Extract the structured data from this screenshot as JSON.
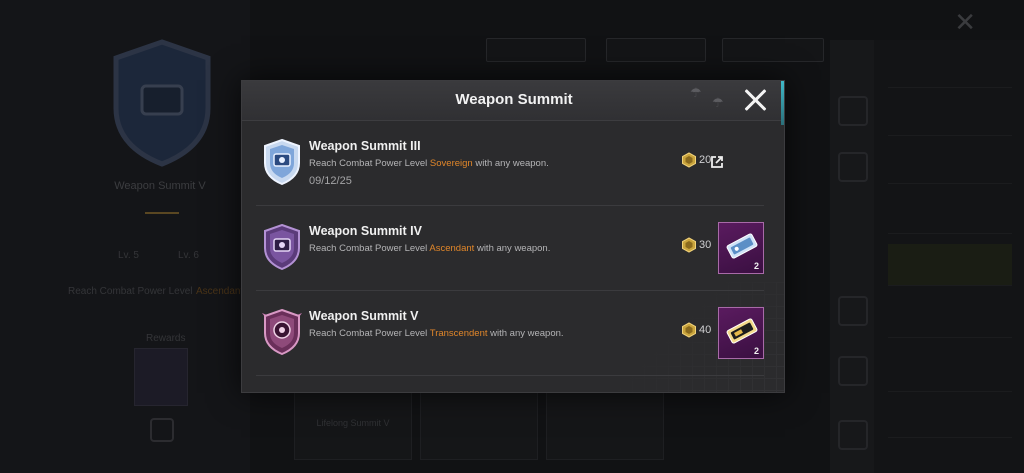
{
  "background": {
    "top_right_label": "",
    "left_panel": {
      "badge_name": "Weapon Summit V",
      "progress_left": "Lv. 5",
      "progress_right": "Lv. 6",
      "hint_text": "Reach Combat Power Level",
      "hint_highlight": "Ascendant",
      "rewards_label": "Rewards"
    },
    "filters": [
      "",
      "",
      ""
    ],
    "right_menu": [
      "",
      "",
      "",
      "",
      "",
      "",
      "",
      "",
      ""
    ],
    "bottom_cards": [
      "Lifelong Summit V",
      "",
      ""
    ]
  },
  "modal": {
    "title": "Weapon Summit",
    "rows": [
      {
        "title": "Weapon Summit III",
        "desc_before": "Reach Combat Power Level ",
        "desc_highlight": "Sovereign",
        "desc_after": " with any weapon.",
        "date": "09/12/25",
        "points": "20",
        "has_link": true,
        "badge_color": "#8fb5e8",
        "badge_tier": "silver-blue"
      },
      {
        "title": "Weapon Summit IV",
        "desc_before": "Reach Combat Power Level ",
        "desc_highlight": "Ascendant",
        "desc_after": " with any weapon.",
        "date": "",
        "points": "30",
        "item_count": "2",
        "item_icon": "blue-ticket-icon",
        "badge_color": "#8a5bb0",
        "badge_tier": "purple"
      },
      {
        "title": "Weapon Summit V",
        "desc_before": "Reach Combat Power Level ",
        "desc_highlight": "Transcendent",
        "desc_after": " with any weapon.",
        "date": "",
        "points": "40",
        "item_count": "2",
        "item_icon": "gold-ticket-icon",
        "badge_color": "#b05a8f",
        "badge_tier": "pink"
      }
    ],
    "colors": {
      "highlight": "#e0862a",
      "accent": "#3fb9c9",
      "item_border": "#a86aa8"
    }
  }
}
